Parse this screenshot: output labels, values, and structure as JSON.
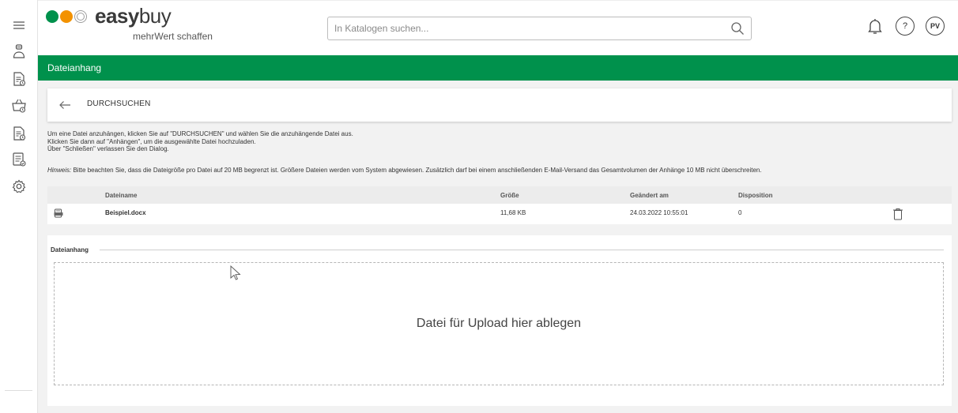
{
  "app": {
    "brand_bold": "easy",
    "brand_light": "buy",
    "tagline": "mehrWert schaffen",
    "logo_colors": [
      "#00914c",
      "#f39200",
      "#9e9e9e"
    ]
  },
  "search": {
    "placeholder": "In Katalogen suchen..."
  },
  "header_icons": {
    "bell": "bell-icon",
    "help": "?",
    "user": "PV"
  },
  "sidebar": {
    "items": [
      {
        "icon": "menu-icon"
      },
      {
        "icon": "user-icon"
      },
      {
        "icon": "document-clock-icon"
      },
      {
        "icon": "basket-clock-icon"
      },
      {
        "icon": "document-clock-icon"
      },
      {
        "icon": "list-check-icon"
      },
      {
        "icon": "gear-icon"
      }
    ]
  },
  "dialog": {
    "title": "Dateianhang",
    "browse_label": "DURCHSUCHEN",
    "instructions": [
      "Um eine Datei anzuhängen, klicken Sie auf \"DURCHSUCHEN\" und wählen Sie die anzuhängende Datei aus.",
      "Klicken Sie dann auf \"Anhängen\", um die ausgewählte Datei hochzuladen.",
      "Über \"Schließen\" verlassen Sie den Dialog."
    ],
    "hint_label": "Hinweis:",
    "hint_text": " Bitte beachten Sie, dass die Dateigröße pro Datei auf 20 MB begrenzt ist. Größere Dateien werden vom System abgewiesen. Zusätzlich darf bei einem anschließenden E-Mail-Versand das Gesamtvolumen der Anhänge 10 MB nicht überschreiten."
  },
  "table": {
    "columns": [
      "Dateiname",
      "Größe",
      "Geändert am",
      "Disposition"
    ],
    "rows": [
      {
        "name": "Beispiel.docx",
        "size": "11,68 KB",
        "modified": "24.03.2022 10:55:01",
        "disposition": "0"
      }
    ]
  },
  "upload": {
    "legend": "Dateianhang",
    "drop_text": "Datei für Upload hier ablegen"
  },
  "colors": {
    "accent": "#00914c"
  }
}
